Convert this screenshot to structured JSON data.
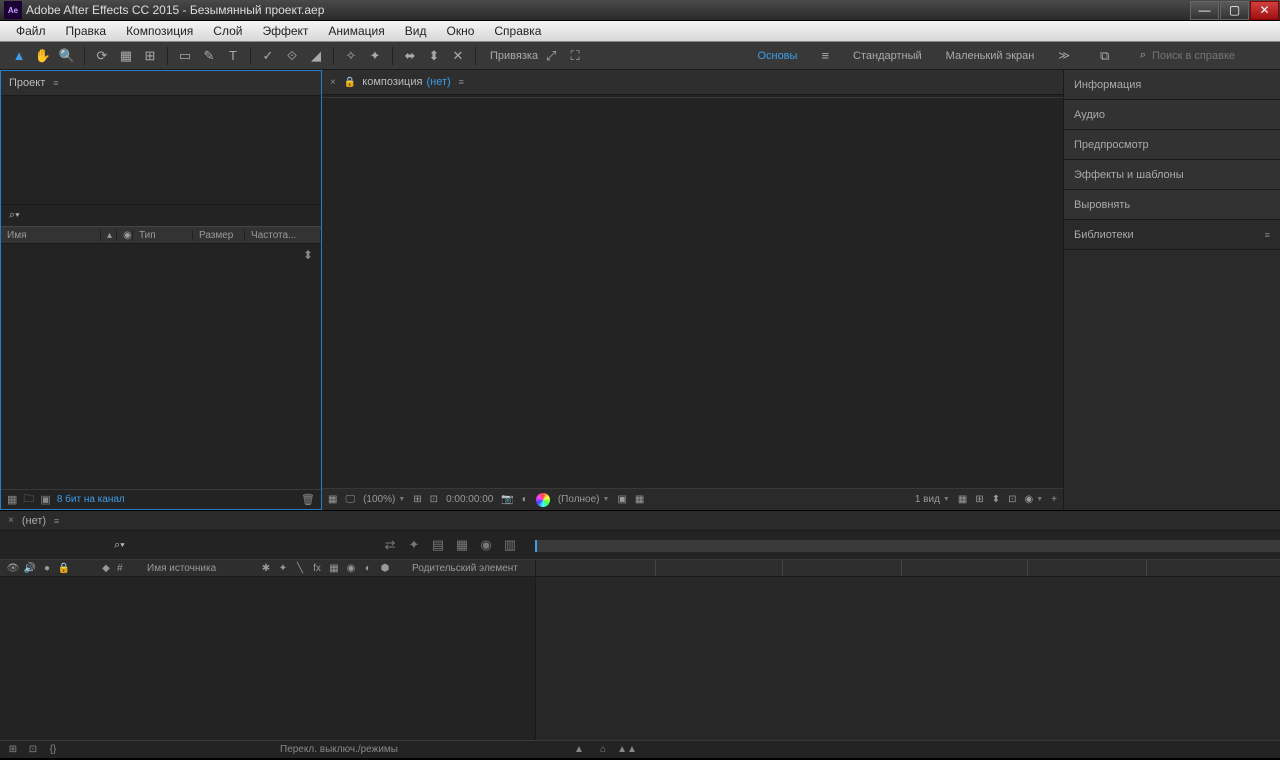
{
  "titlebar": {
    "app": "Ae",
    "title": "Adobe After Effects CC 2015 - Безымянный проект.aep"
  },
  "menu": {
    "items": [
      "Файл",
      "Правка",
      "Композиция",
      "Слой",
      "Эффект",
      "Анимация",
      "Вид",
      "Окно",
      "Справка"
    ]
  },
  "toolbar": {
    "binding": "Привязка",
    "workspaces": {
      "basics": "Основы",
      "standard": "Стандартный",
      "small": "Маленький экран",
      "more": "≫"
    },
    "search_placeholder": "Поиск в справке"
  },
  "project": {
    "title": "Проект",
    "columns": {
      "name": "Имя",
      "type": "Тип",
      "size": "Размер",
      "freq": "Частота..."
    },
    "bits": "8 бит на канал"
  },
  "composition": {
    "label": "композиция",
    "none": "(нет)",
    "viewer": {
      "zoom": "(100%)",
      "time": "0:00:00:00",
      "quality": "(Полное)",
      "views": "1 вид",
      "plus": "+"
    }
  },
  "sidepanels": {
    "info": "Информация",
    "audio": "Аудио",
    "preview": "Предпросмотр",
    "effects": "Эффекты и шаблоны",
    "align": "Выровнять",
    "libraries": "Библиотеки"
  },
  "timeline": {
    "none": "(нет)",
    "cols": {
      "hash": "#",
      "source": "Имя источника",
      "parent": "Родительский элемент"
    },
    "footer": "Перекл. выключ./режимы"
  }
}
